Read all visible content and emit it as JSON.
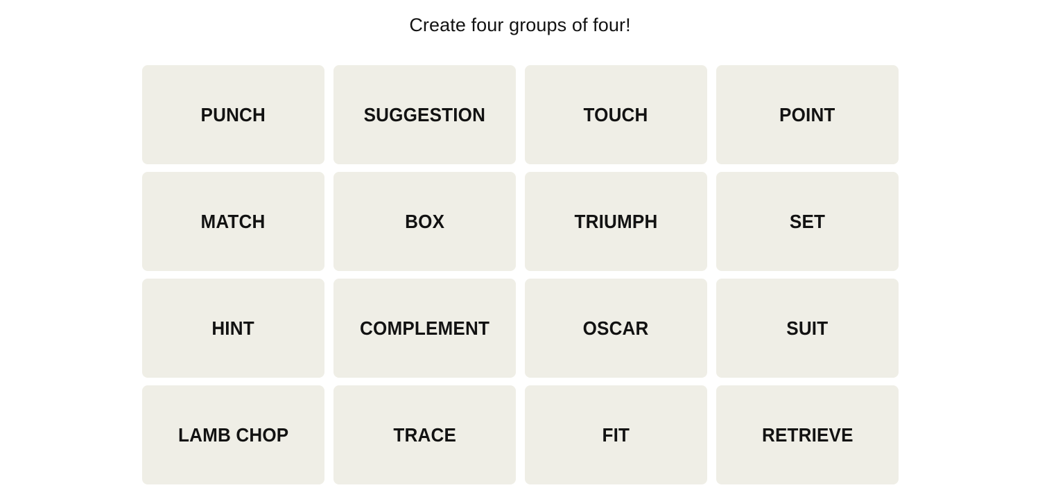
{
  "game": {
    "title": "Create four groups of four!",
    "colors": {
      "page_background": "#ffffff",
      "tile_background": "#efeee6",
      "tile_text": "#121212",
      "title_text": "#121212"
    },
    "grid": {
      "rows": 4,
      "columns": 4,
      "tiles": [
        {
          "label": "PUNCH"
        },
        {
          "label": "SUGGESTION"
        },
        {
          "label": "TOUCH"
        },
        {
          "label": "POINT"
        },
        {
          "label": "MATCH"
        },
        {
          "label": "BOX"
        },
        {
          "label": "TRIUMPH"
        },
        {
          "label": "SET"
        },
        {
          "label": "HINT"
        },
        {
          "label": "COMPLEMENT"
        },
        {
          "label": "OSCAR"
        },
        {
          "label": "SUIT"
        },
        {
          "label": "LAMB CHOP"
        },
        {
          "label": "TRACE"
        },
        {
          "label": "FIT"
        },
        {
          "label": "RETRIEVE"
        }
      ]
    }
  }
}
